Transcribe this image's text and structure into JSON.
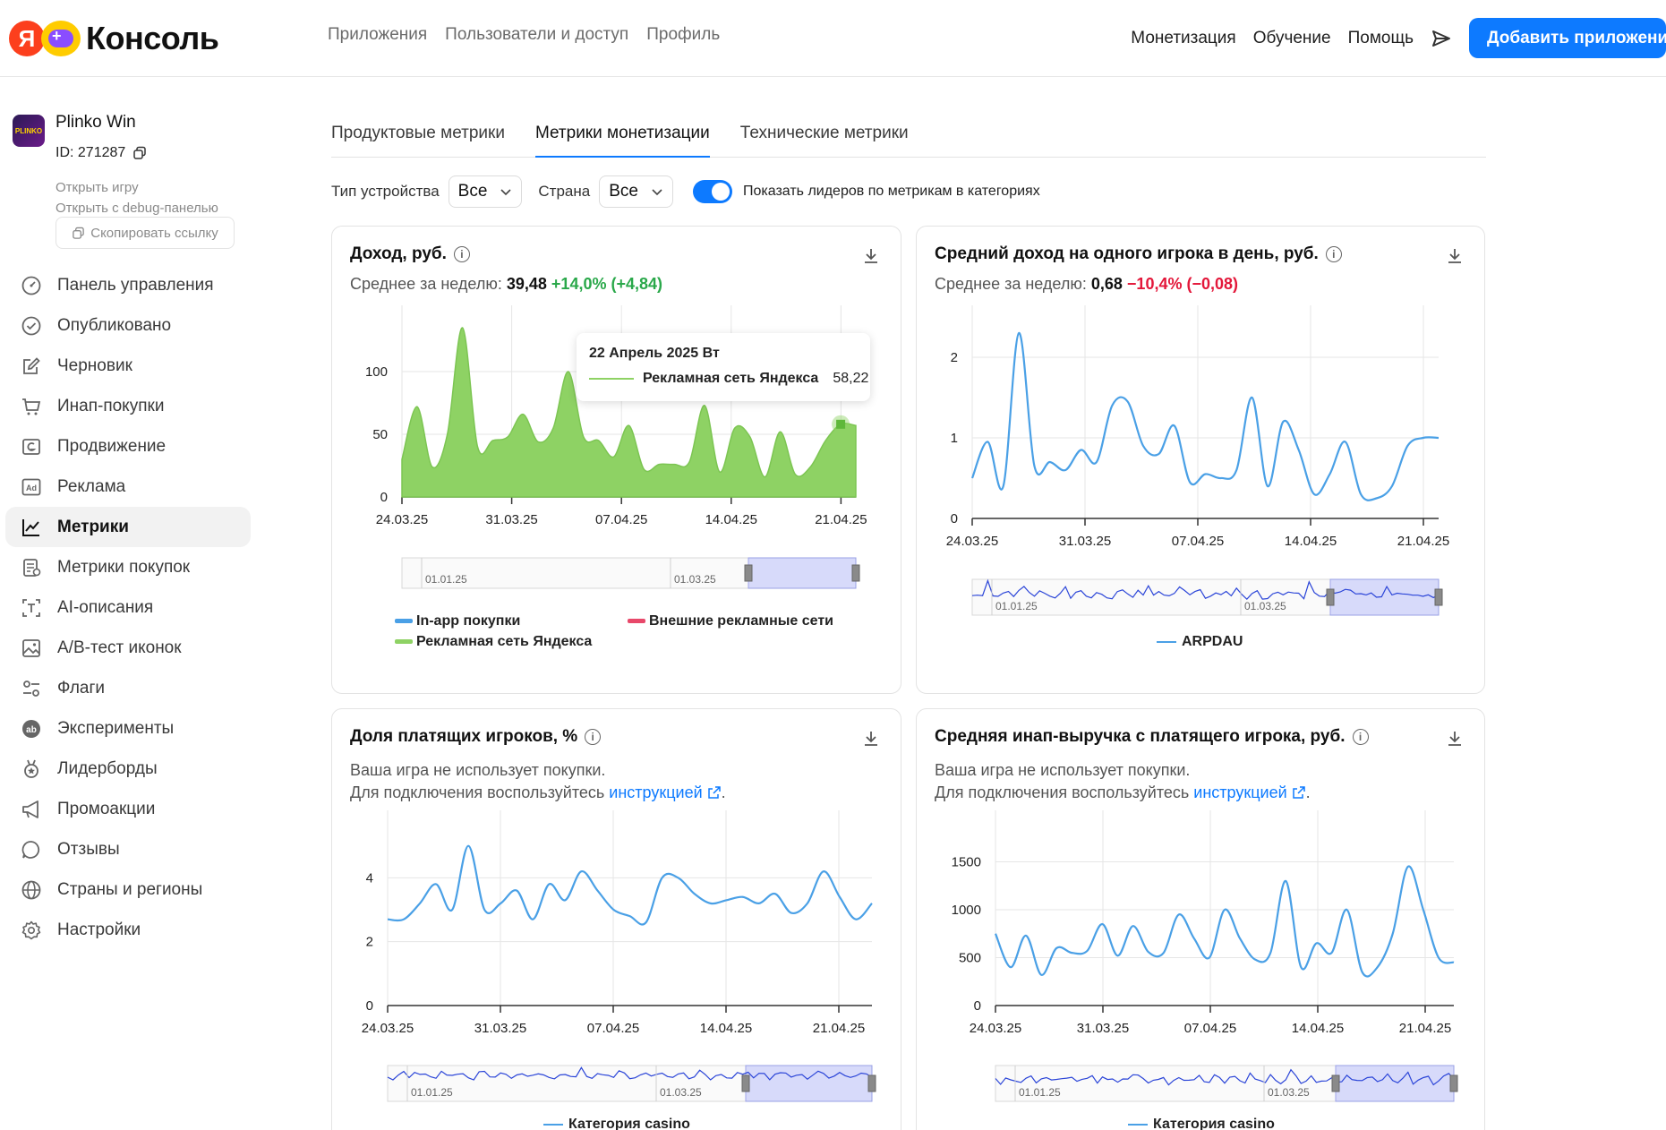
{
  "header": {
    "logo_letter": "Я",
    "logo_text": "Консоль",
    "nav": [
      "Приложения",
      "Пользователи и доступ",
      "Профиль"
    ],
    "right_nav": [
      "Монетизация",
      "Обучение",
      "Помощь"
    ],
    "add_button": "Добавить приложение"
  },
  "app": {
    "icon_text": "PLINKO",
    "name": "Plinko Win",
    "id_label": "ID: 271287",
    "open_game": "Открыть игру",
    "open_debug": "Открыть с debug-панелью",
    "copy_link": "Скопировать ссылку"
  },
  "sidebar": {
    "items": [
      {
        "label": "Панель управления",
        "icon": "dashboard-icon"
      },
      {
        "label": "Опубликовано",
        "icon": "check-circle-icon"
      },
      {
        "label": "Черновик",
        "icon": "edit-icon"
      },
      {
        "label": "Инап-покупки",
        "icon": "cart-icon"
      },
      {
        "label": "Продвижение",
        "icon": "promotion-icon"
      },
      {
        "label": "Реклама",
        "icon": "ad-icon"
      },
      {
        "label": "Метрики",
        "icon": "chart-icon",
        "active": true
      },
      {
        "label": "Метрики покупок",
        "icon": "purchase-metrics-icon"
      },
      {
        "label": "AI-описания",
        "icon": "ai-text-icon"
      },
      {
        "label": "A/B-тест иконок",
        "icon": "image-icon"
      },
      {
        "label": "Флаги",
        "icon": "flags-icon"
      },
      {
        "label": "Эксперименты",
        "icon": "ab-icon"
      },
      {
        "label": "Лидерборды",
        "icon": "medal-icon"
      },
      {
        "label": "Промоакции",
        "icon": "megaphone-icon"
      },
      {
        "label": "Отзывы",
        "icon": "chat-icon"
      },
      {
        "label": "Страны и регионы",
        "icon": "globe-icon"
      },
      {
        "label": "Настройки",
        "icon": "gear-icon"
      }
    ]
  },
  "tabs": [
    "Продуктовые метрики",
    "Метрики монетизации",
    "Технические метрики"
  ],
  "filters": {
    "device_label": "Тип устройства",
    "device_value": "Все",
    "country_label": "Страна",
    "country_value": "Все",
    "toggle_label": "Показать лидеров по метрикам в категориях",
    "toggle_on": true
  },
  "cards": {
    "revenue": {
      "title": "Доход, руб.",
      "avg_label": "Среднее за неделю:",
      "avg_value": "39,48",
      "avg_change": "+14,0% (+4,84)",
      "legend": [
        "In-app покупки",
        "Внешние рекламные сети",
        "Рекламная сеть Яндекса"
      ],
      "tooltip": {
        "date": "22 Апрель 2025 Вт",
        "series": "Рекламная сеть Яндекса",
        "value": "58,22"
      },
      "nav_labels": [
        "01.01.25",
        "01.03.25"
      ]
    },
    "arpdau": {
      "title": "Средний доход на одного игрока в день, руб.",
      "avg_label": "Среднее за неделю:",
      "avg_value": "0,68",
      "avg_change": "−10,4% (−0,08)",
      "legend": "ARPDAU",
      "nav_labels": [
        "01.01.25",
        "01.03.25"
      ]
    },
    "paying_share": {
      "title": "Доля платящих игроков, %",
      "note1": "Ваша игра не использует покупки.",
      "note2_prefix": "Для подключения воспользуйтесь ",
      "note2_link": "инструкцией",
      "note2_suffix": ".",
      "legend": "Категория casino",
      "nav_labels": [
        "01.01.25",
        "01.03.25"
      ]
    },
    "arppu": {
      "title": "Средняя инап-выручка с платящего игрока, руб.",
      "note1": "Ваша игра не использует покупки.",
      "note2_prefix": "Для подключения воспользуйтесь ",
      "note2_link": "инструкцией",
      "note2_suffix": ".",
      "legend": "Категория casino",
      "nav_labels": [
        "01.01.25",
        "01.03.25"
      ]
    }
  },
  "colors": {
    "accent": "#0d7aff",
    "green_area": "#8ed264",
    "line_blue": "#4aa0e6",
    "nav_line": "#2b45d8",
    "positive": "#2aa84a",
    "negative": "#e3173a",
    "inapp": "#4aa0e6",
    "external": "#e8486a"
  },
  "chart_data": [
    {
      "type": "area",
      "title": "Доход, руб.",
      "x_ticks": [
        "24.03.25",
        "31.03.25",
        "07.04.25",
        "14.04.25",
        "21.04.25"
      ],
      "y_ticks": [
        0,
        50,
        100
      ],
      "ylim": [
        0,
        150
      ],
      "series": [
        {
          "name": "Рекламная сеть Яндекса",
          "x": [
            "24.03.25",
            "25.03.25",
            "26.03.25",
            "27.03.25",
            "28.03.25",
            "29.03.25",
            "30.03.25",
            "31.03.25",
            "01.04.25",
            "02.04.25",
            "03.04.25",
            "04.04.25",
            "05.04.25",
            "06.04.25",
            "07.04.25",
            "08.04.25",
            "09.04.25",
            "10.04.25",
            "11.04.25",
            "12.04.25",
            "13.04.25",
            "14.04.25",
            "15.04.25",
            "16.04.25",
            "17.04.25",
            "18.04.25",
            "19.04.25",
            "20.04.25",
            "21.04.25",
            "22.04.25",
            "23.04.25"
          ],
          "values": [
            30,
            72,
            24,
            50,
            135,
            40,
            45,
            48,
            66,
            44,
            55,
            100,
            48,
            45,
            32,
            57,
            22,
            26,
            26,
            28,
            73,
            20,
            55,
            48,
            16,
            52,
            18,
            24,
            45,
            58,
            57
          ]
        }
      ]
    },
    {
      "type": "line",
      "title": "Средний доход на одного игрока в день, руб.",
      "x_ticks": [
        "24.03.25",
        "31.03.25",
        "07.04.25",
        "14.04.25",
        "21.04.25"
      ],
      "y_ticks": [
        0,
        1,
        2
      ],
      "ylim": [
        0,
        2.6
      ],
      "series": [
        {
          "name": "ARPDAU",
          "x": [
            "24.03.25",
            "25.03.25",
            "26.03.25",
            "27.03.25",
            "28.03.25",
            "29.03.25",
            "30.03.25",
            "31.03.25",
            "01.04.25",
            "02.04.25",
            "03.04.25",
            "04.04.25",
            "05.04.25",
            "06.04.25",
            "07.04.25",
            "08.04.25",
            "09.04.25",
            "10.04.25",
            "11.04.25",
            "12.04.25",
            "13.04.25",
            "14.04.25",
            "15.04.25",
            "16.04.25",
            "17.04.25",
            "18.04.25",
            "19.04.25",
            "20.04.25",
            "21.04.25",
            "22.04.25",
            "23.04.25"
          ],
          "values": [
            0.5,
            0.95,
            0.4,
            2.3,
            0.65,
            0.7,
            0.6,
            0.85,
            0.7,
            1.4,
            1.45,
            0.9,
            0.8,
            1.15,
            0.45,
            0.55,
            0.5,
            0.6,
            1.5,
            0.4,
            1.2,
            0.85,
            0.3,
            0.55,
            0.95,
            0.3,
            0.25,
            0.4,
            0.9,
            1.0,
            1.0
          ]
        }
      ]
    },
    {
      "type": "line",
      "title": "Доля платящих игроков, %",
      "x_ticks": [
        "24.03.25",
        "31.03.25",
        "07.04.25",
        "14.04.25",
        "21.04.25"
      ],
      "y_ticks": [
        0,
        2,
        4
      ],
      "ylim": [
        0,
        6
      ],
      "series": [
        {
          "name": "Категория casino",
          "x": [
            "24.03.25",
            "25.03.25",
            "26.03.25",
            "27.03.25",
            "28.03.25",
            "29.03.25",
            "30.03.25",
            "31.03.25",
            "01.04.25",
            "02.04.25",
            "03.04.25",
            "04.04.25",
            "05.04.25",
            "06.04.25",
            "07.04.25",
            "08.04.25",
            "09.04.25",
            "10.04.25",
            "11.04.25",
            "12.04.25",
            "13.04.25",
            "14.04.25",
            "15.04.25",
            "16.04.25",
            "17.04.25",
            "18.04.25",
            "19.04.25",
            "20.04.25",
            "21.04.25",
            "22.04.25",
            "23.04.25"
          ],
          "values": [
            2.7,
            2.7,
            3.2,
            3.8,
            3.0,
            5.0,
            3.0,
            3.2,
            3.6,
            2.7,
            3.8,
            3.3,
            4.2,
            3.6,
            3.0,
            2.8,
            2.6,
            4.0,
            4.0,
            3.5,
            3.2,
            3.3,
            3.4,
            3.2,
            3.5,
            2.9,
            3.2,
            4.2,
            3.4,
            2.7,
            3.2
          ]
        }
      ]
    },
    {
      "type": "line",
      "title": "Средняя инап-выручка с платящего игрока, руб.",
      "x_ticks": [
        "24.03.25",
        "31.03.25",
        "07.04.25",
        "14.04.25",
        "21.04.25"
      ],
      "y_ticks": [
        0,
        500,
        1000,
        1500
      ],
      "ylim": [
        0,
        2000
      ],
      "series": [
        {
          "name": "Категория casino",
          "x": [
            "24.03.25",
            "25.03.25",
            "26.03.25",
            "27.03.25",
            "28.03.25",
            "29.03.25",
            "30.03.25",
            "31.03.25",
            "01.04.25",
            "02.04.25",
            "03.04.25",
            "04.04.25",
            "05.04.25",
            "06.04.25",
            "07.04.25",
            "08.04.25",
            "09.04.25",
            "10.04.25",
            "11.04.25",
            "12.04.25",
            "13.04.25",
            "14.04.25",
            "15.04.25",
            "16.04.25",
            "17.04.25",
            "18.04.25",
            "19.04.25",
            "20.04.25",
            "21.04.25",
            "22.04.25",
            "23.04.25"
          ],
          "values": [
            750,
            400,
            730,
            320,
            600,
            550,
            570,
            850,
            520,
            830,
            560,
            550,
            950,
            700,
            500,
            1000,
            700,
            480,
            550,
            1300,
            400,
            650,
            550,
            1000,
            350,
            400,
            750,
            1450,
            1000,
            500,
            450
          ]
        }
      ]
    }
  ]
}
